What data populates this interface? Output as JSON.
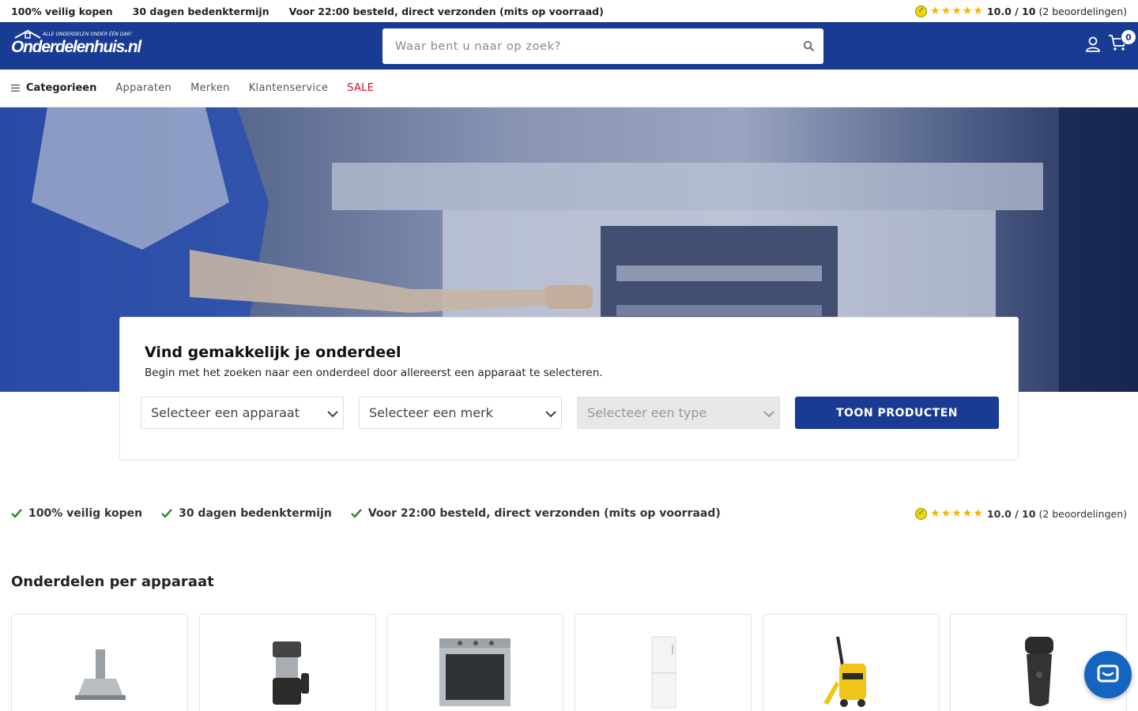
{
  "usp_top": {
    "items": [
      "100% veilig kopen",
      "30 dagen bedenktermijn",
      "Voor 22:00 besteld, direct verzonden (mits op voorraad)"
    ]
  },
  "rating": {
    "stars": "★★★★★",
    "score": "10.0 / 10",
    "count": "(2 beoordelingen)"
  },
  "header": {
    "logo_name": "Onderdelenhuis.nl",
    "logo_tagline": "ALLE ONDERDELEN ONDER ÉÉN DAK!",
    "search_placeholder": "Waar bent u naar op zoek?",
    "cart_count": "0",
    "brand_color": "#1a3b94"
  },
  "nav": {
    "categories_label": "Categorieen",
    "links": [
      "Apparaten",
      "Merken",
      "Klantenservice"
    ],
    "sale_label": "SALE",
    "sale_color": "#c8102e"
  },
  "finder": {
    "title": "Vind gemakkelijk je onderdeel",
    "subtitle": "Begin met het zoeken naar een onderdeel door allereerst een apparaat te selecteren.",
    "select_device": "Selecteer een apparaat",
    "select_brand": "Selecteer een merk",
    "select_type": "Selecteer een type",
    "button_label": "TOON PRODUCTEN"
  },
  "usp_bar": {
    "items": [
      "100% veilig kopen",
      "30 dagen bedenktermijn",
      "Voor 22:00 besteld, direct verzonden (mits op voorraad)"
    ]
  },
  "section": {
    "title": "Onderdelen per apparaat",
    "cards": [
      "cooker-hood",
      "coffee-maker",
      "oven",
      "refrigerator",
      "pressure-washer",
      "shaver"
    ]
  },
  "icons": {
    "search": "search-icon",
    "user": "user-icon",
    "cart": "cart-icon",
    "menu": "menu-icon",
    "check": "check-icon",
    "chevron": "chevron-down-icon",
    "chat": "chat-icon"
  }
}
